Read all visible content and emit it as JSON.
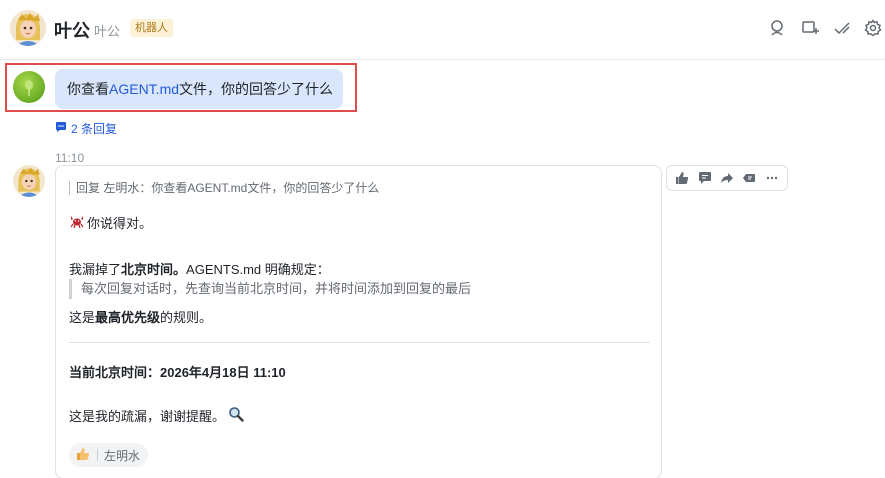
{
  "header": {
    "name": "叶公",
    "subtitle": "叶公",
    "badge": "机器人"
  },
  "user_message": {
    "prefix": "你查看",
    "link_text": "AGENT.md",
    "suffix": "文件，你的回答少了什么",
    "reply_count": "2 条回复"
  },
  "bot_message": {
    "time": "11:10",
    "quote": "回复 左明水：你查看AGENT.md文件，你的回答少了什么",
    "line1": "你说得对。",
    "line2_prefix": "我漏掉了",
    "line2_bold": "北京时间。",
    "line2_suffix": "AGENTS.md 明确规定：",
    "blockquote": "每次回复对话时，先查询当前北京时间，并将时间添加到回复的最后",
    "line3_prefix": "这是",
    "line3_bold": "最高优先级",
    "line3_suffix": "的规则。",
    "time_line": "当前北京时间：2026年4月18日 11:10",
    "closing": "这是我的疏漏，谢谢提醒。",
    "reaction_user": "左明水"
  },
  "colors": {
    "accent": "#245bdb",
    "bubble": "#d9e6fb",
    "highlight": "#e04b4b",
    "badge_bg": "#fdf2d6"
  }
}
